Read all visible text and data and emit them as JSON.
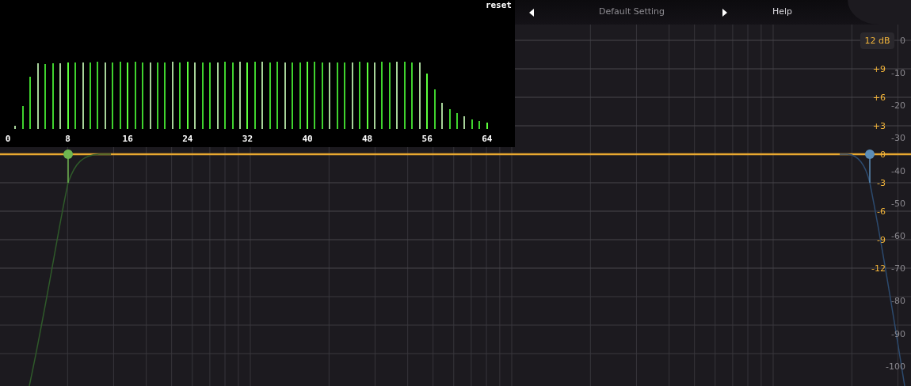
{
  "spectrum": {
    "reset_label": "reset",
    "x_ticks": [
      "0",
      "8",
      "16",
      "24",
      "32",
      "40",
      "48",
      "56",
      "64"
    ]
  },
  "header": {
    "preset": "Default Setting",
    "help": "Help"
  },
  "eq": {
    "range_badge": "12 dB",
    "gain_labels": [
      "+9",
      "+6",
      "+3",
      "0",
      "-3",
      "-6",
      "-9",
      "-12"
    ],
    "level_labels": [
      "0",
      "-10",
      "-20",
      "-30",
      "-40",
      "-50",
      "-60",
      "-70",
      "-80",
      "-90",
      "-100"
    ],
    "bands": [
      {
        "color": "#6fb550"
      },
      {
        "color": "#5b8db8"
      }
    ]
  }
}
